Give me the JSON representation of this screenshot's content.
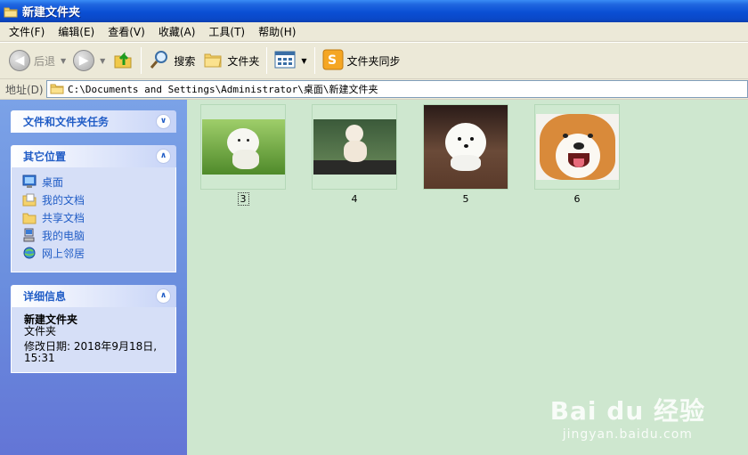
{
  "window": {
    "title": "新建文件夹"
  },
  "menu": [
    "文件(F)",
    "编辑(E)",
    "查看(V)",
    "收藏(A)",
    "工具(T)",
    "帮助(H)"
  ],
  "toolbar": {
    "back": "后退",
    "search": "搜索",
    "folders": "文件夹",
    "sync": "文件夹同步"
  },
  "address": {
    "label": "地址(D)",
    "path": "C:\\Documents and Settings\\Administrator\\桌面\\新建文件夹"
  },
  "tasks": {
    "file_tasks_title": "文件和文件夹任务",
    "other_places_title": "其它位置",
    "other_places": [
      {
        "label": "桌面",
        "icon": "desktop-icon"
      },
      {
        "label": "我的文档",
        "icon": "my-documents-icon"
      },
      {
        "label": "共享文档",
        "icon": "shared-documents-icon"
      },
      {
        "label": "我的电脑",
        "icon": "my-computer-icon"
      },
      {
        "label": "网上邻居",
        "icon": "network-icon"
      }
    ],
    "details_title": "详细信息",
    "details": {
      "name": "新建文件夹",
      "type": "文件夹",
      "modified_label": "修改日期: 2018年9月18日,",
      "modified_time": "15:31"
    }
  },
  "files": [
    {
      "name": "3",
      "selected": true
    },
    {
      "name": "4",
      "selected": false
    },
    {
      "name": "5",
      "selected": false
    },
    {
      "name": "6",
      "selected": false
    }
  ],
  "watermark": {
    "brand": "Bai du 经验",
    "url": "jingyan.baidu.com"
  },
  "colors": {
    "title_blue": "#0a4fd4",
    "task_link": "#215dc6",
    "content_bg": "#cee7cf",
    "pane_bg": "#6b8fde"
  }
}
